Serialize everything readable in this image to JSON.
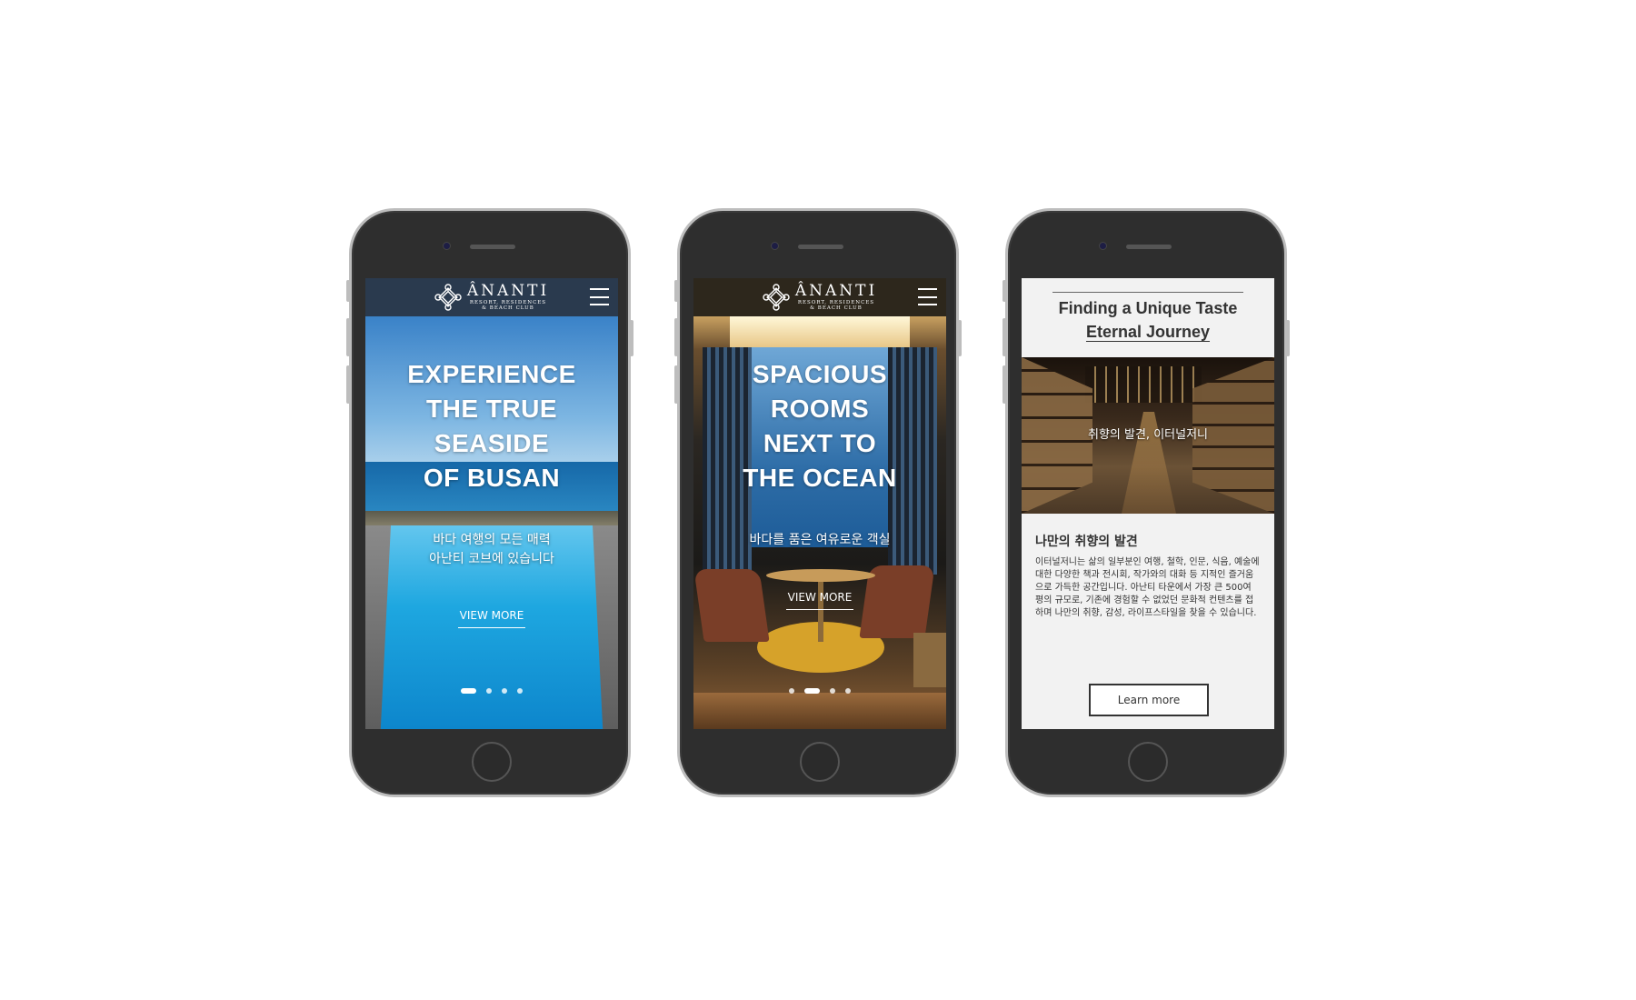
{
  "brand": {
    "name": "ÂNANTI",
    "subtitle_line1": "RESORT, RESIDENCES",
    "subtitle_line2": "& BEACH CLUB"
  },
  "screens": [
    {
      "title_lines": [
        "EXPERIENCE",
        "THE TRUE",
        "SEASIDE",
        "OF BUSAN"
      ],
      "subtitle_lines": [
        "바다 여행의 모든 매력",
        "아난티 코브에 있습니다"
      ],
      "cta": "VIEW MORE",
      "carousel": {
        "count": 4,
        "active": 1
      }
    },
    {
      "title_lines": [
        "SPACIOUS",
        "ROOMS",
        "NEXT TO",
        "THE OCEAN"
      ],
      "subtitle_lines": [
        "바다를 품은 여유로운 객실"
      ],
      "cta": "VIEW MORE",
      "carousel": {
        "count": 4,
        "active": 2
      }
    },
    {
      "title_line1": "Finding a Unique Taste",
      "title_line2": "Eternal Journey",
      "image_caption": "취향의 발견, 이터널저니",
      "heading": "나만의 취향의 발견",
      "body": "이터널저니는 삶의 일부분인 여행, 철학, 인문, 식음, 예술에 대한 다양한 책과 전시회, 작가와의 대화 등 지적인 즐거움으로 가득한 공간입니다. 아난티 타운에서 가장 큰 500여 평의 규모로, 기존에 경험할 수 없었던 문화적 컨텐츠를 접하며 나만의 취향, 감성, 라이프스타일을 찾을 수 있습니다.",
      "cta": "Learn more"
    }
  ],
  "colors": {
    "phone_body": "#2e2e2e",
    "phone_border": "#bdbdbd",
    "header_bg_1": "#2a3a4e",
    "text_dark": "#333333"
  }
}
